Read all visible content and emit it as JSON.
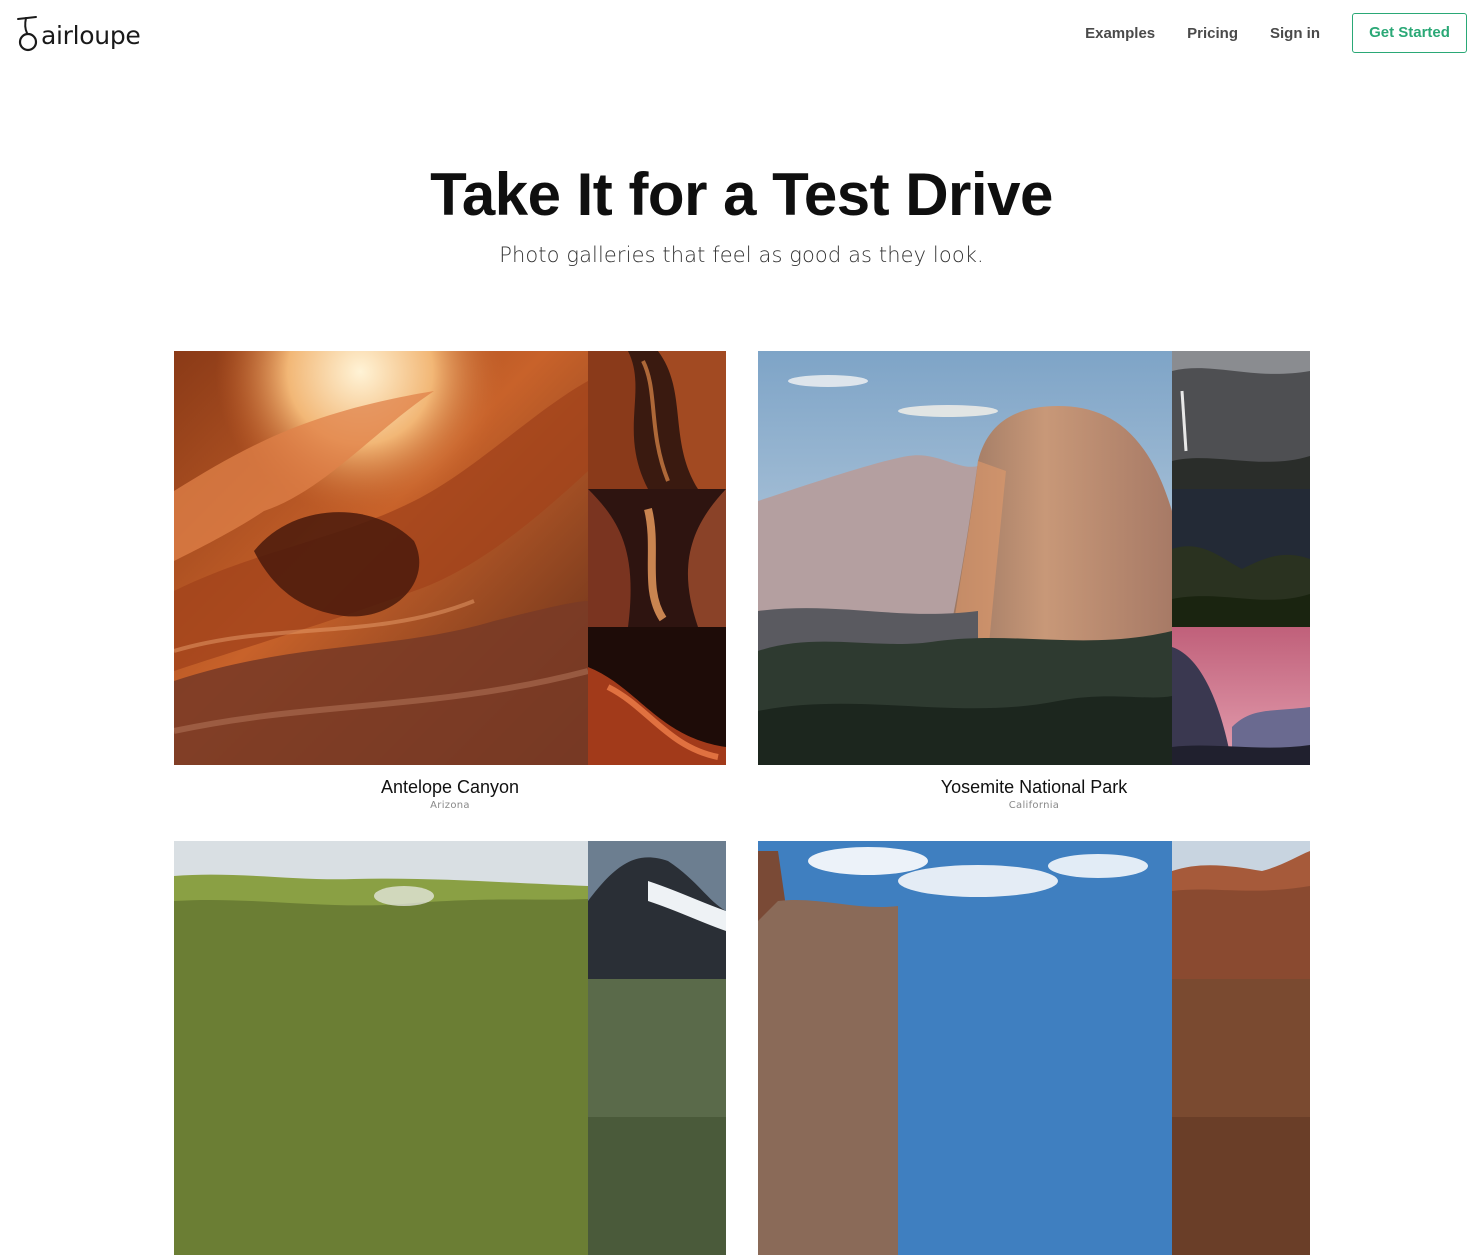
{
  "header": {
    "brand": "airloupe",
    "nav": [
      {
        "label": "Examples"
      },
      {
        "label": "Pricing"
      },
      {
        "label": "Sign in"
      }
    ],
    "cta_label": "Get Started",
    "colors": {
      "accent": "#2aa876",
      "nav_text": "#4a4a4a"
    }
  },
  "hero": {
    "title": "Take It for a Test Drive",
    "subtitle": "Photo galleries that feel as good as they look."
  },
  "galleries": [
    {
      "title": "Antelope Canyon",
      "location": "Arizona",
      "theme": "canyon"
    },
    {
      "title": "Yosemite National Park",
      "location": "California",
      "theme": "mountain"
    },
    {
      "title": "",
      "location": "",
      "theme": "green-hills"
    },
    {
      "title": "",
      "location": "",
      "theme": "desert-cliffs"
    }
  ]
}
